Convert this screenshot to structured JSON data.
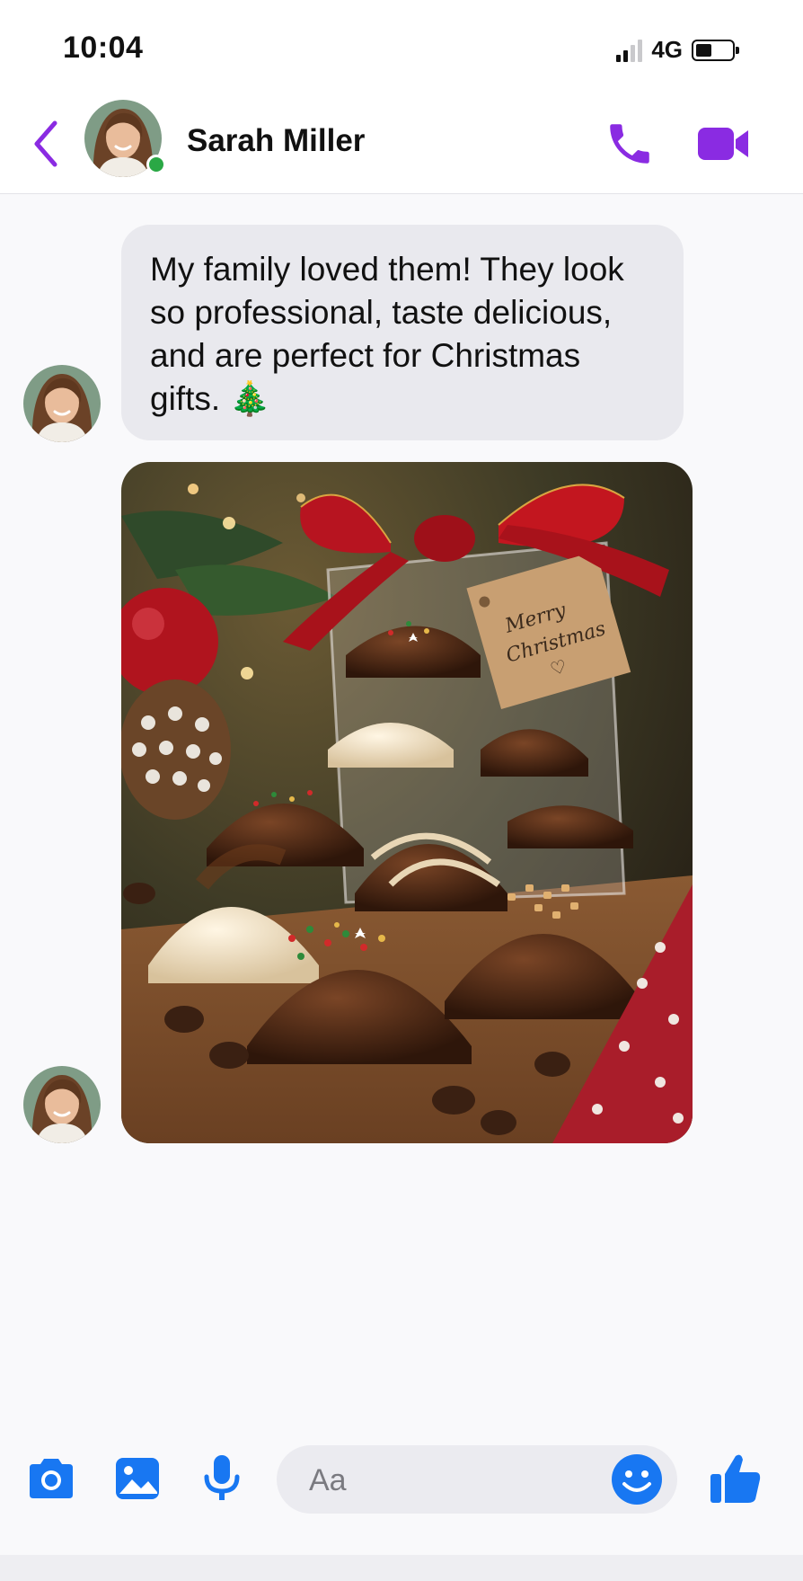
{
  "status_bar": {
    "time": "10:04",
    "network": "4G",
    "signal_bars": 2,
    "battery_level": 0.45
  },
  "header": {
    "contact_name": "Sarah Miller",
    "online": true
  },
  "messages": [
    {
      "type": "text",
      "text": "My family loved them! They look so professional, taste delicious, and are perfect for Christmas gifts. 🎄"
    },
    {
      "type": "image",
      "tag_text": "Merry Christmas"
    }
  ],
  "composer": {
    "placeholder": "Aa"
  },
  "icons": [
    "back-chevron-icon",
    "phone-icon",
    "video-camera-icon",
    "camera-icon",
    "gallery-icon",
    "microphone-icon",
    "smiley-icon",
    "thumbs-up-icon"
  ],
  "colors": {
    "accent_purple": "#8a2be2",
    "accent_blue": "#1877f2",
    "online_green": "#2aa845",
    "bubble_bg": "#e9e9ee"
  }
}
